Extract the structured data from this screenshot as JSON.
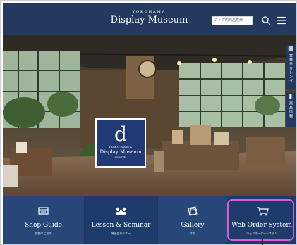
{
  "header": {
    "logo_small": "YOKOHAMA",
    "logo_big": "Display Museum",
    "search_placeholder": "ストア内商品検索",
    "search_icon": "search-icon",
    "menu_icon": "menu-icon"
  },
  "hero": {
    "card": {
      "glyph": "d",
      "small": "YOKOHAMA",
      "big": "Display Museum",
      "tiny": "since 1990"
    },
    "sidetabs": [
      {
        "icon": "calendar-icon",
        "label": "営業日カレンダー"
      },
      {
        "icon": "book-icon",
        "label": "商品情報"
      }
    ]
  },
  "nav": {
    "items": [
      {
        "label": "Shop Guide",
        "sub": "店舗のご案内",
        "icon": "store-icon"
      },
      {
        "label": "Lesson & Seminar",
        "sub": "講習会セミナー",
        "icon": "people-icon"
      },
      {
        "label": "Gallery",
        "sub": "作品",
        "icon": "gallery-icon"
      },
      {
        "label": "Web Order System",
        "sub": "ウェブオーダーシステム",
        "icon": "cart-icon"
      }
    ]
  },
  "colors": {
    "header_bg": "#23395f",
    "nav_bg": "#264777",
    "highlight": "#d85bd4",
    "card_bg": "#1f3a74"
  }
}
